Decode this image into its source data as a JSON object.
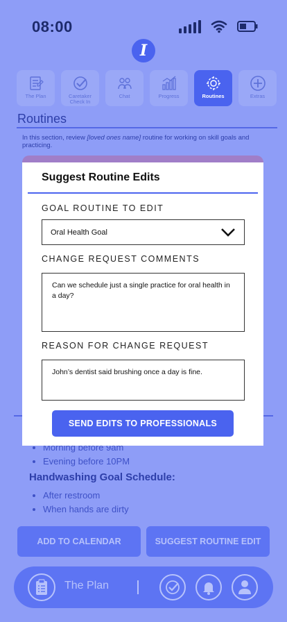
{
  "status": {
    "time": "08:00"
  },
  "logo": {
    "glyph": "I"
  },
  "tabs": [
    {
      "label": "The Plan",
      "icon": "plan-icon",
      "active": false
    },
    {
      "label": "Caretaker Check In",
      "icon": "check-in-icon",
      "active": false
    },
    {
      "label": "Chat",
      "icon": "chat-icon",
      "active": false
    },
    {
      "label": "Progress",
      "icon": "progress-icon",
      "active": false
    },
    {
      "label": "Routines",
      "icon": "routines-icon",
      "active": true
    },
    {
      "label": "Extras",
      "icon": "plus-icon",
      "active": false
    }
  ],
  "page": {
    "title": "Routines",
    "intro_prefix": "In this section, review ",
    "intro_emph": "[loved ones name]",
    "intro_suffix": " routine for working on skill goals and practicing."
  },
  "background": {
    "oral_items": [
      "Morning before 9am",
      "Evening before 10PM"
    ],
    "handwashing_title": "Handwashing Goal Schedule:",
    "handwashing_items": [
      "After restroom",
      "When hands are dirty"
    ],
    "add_calendar_label": "ADD TO CALENDAR",
    "suggest_edit_label": "SUGGEST ROUTINE EDIT"
  },
  "bottom_nav": {
    "label": "The Plan"
  },
  "modal": {
    "title": "Suggest Routine Edits",
    "goal_label": "GOAL ROUTINE TO EDIT",
    "goal_value": "Oral Health Goal",
    "comments_label": "CHANGE REQUEST COMMENTS",
    "comments_value": "Can we schedule just a single practice for oral health in a day?",
    "reason_label": "REASON FOR CHANGE REQUEST",
    "reason_value": "John’s dentist said brushing once a day is fine.",
    "send_label": "SEND EDITS TO PROFESSIONALS"
  },
  "colors": {
    "background": "#8e9df7",
    "accent": "#4a63ef",
    "modal_header": "#a07ec8"
  }
}
